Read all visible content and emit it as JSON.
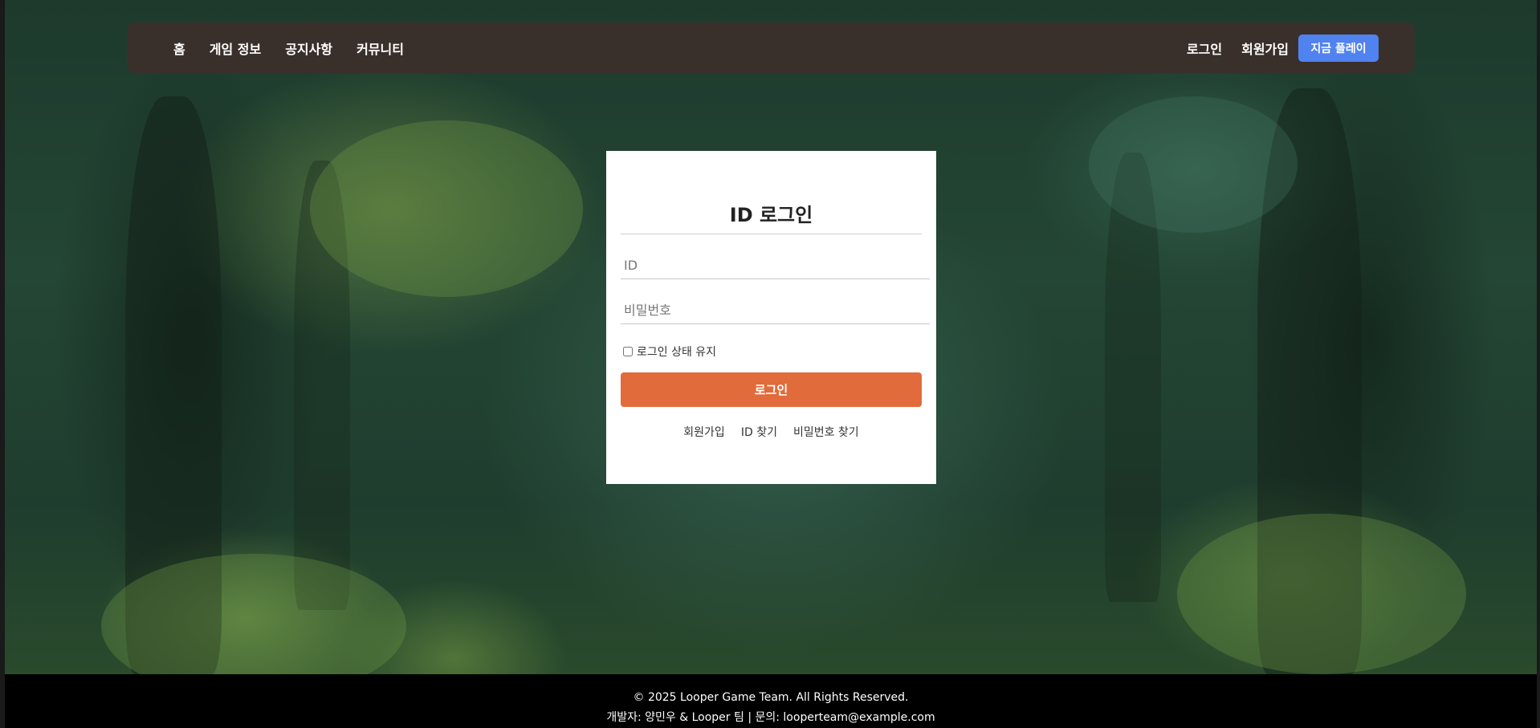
{
  "nav": {
    "left_items": [
      "홈",
      "게임 정보",
      "공지사항",
      "커뮤니티"
    ],
    "login_label": "로그인",
    "signup_label": "회원가입",
    "play_label": "지금 플레이"
  },
  "login": {
    "title": "ID 로그인",
    "id_placeholder": "ID",
    "password_placeholder": "비밀번호",
    "remember_label": "로그인 상태 유지",
    "remember_checked": false,
    "submit_label": "로그인",
    "links": {
      "signup": "회원가입",
      "find_id": "ID 찾기",
      "find_password": "비밀번호 찾기"
    }
  },
  "footer": {
    "copyright": "© 2025 Looper Game Team. All Rights Reserved.",
    "contact": "개발자: 양민우 & Looper 팀 | 문의: looperteam@example.com"
  },
  "colors": {
    "nav_bg": "#3a302b",
    "play_button": "#5082f0",
    "login_button": "#e16b3a",
    "footer_bg": "#000000"
  }
}
